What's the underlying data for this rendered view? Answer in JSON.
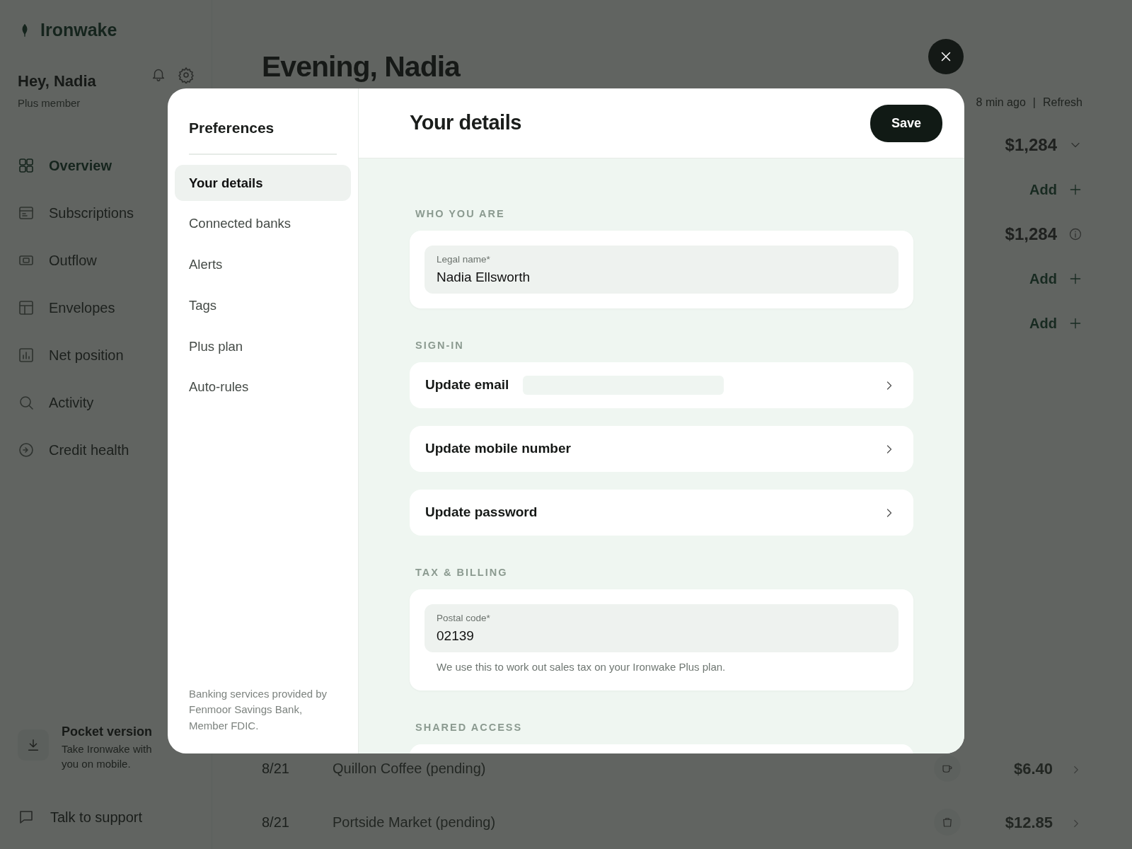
{
  "app": {
    "logo": "Ironwake",
    "greeting": "Hey, Nadia",
    "membership": "Plus member"
  },
  "sidebar": {
    "items": [
      {
        "label": "Overview",
        "kind": "grid",
        "selected": true
      },
      {
        "label": "Subscriptions",
        "kind": "card",
        "selected": false
      },
      {
        "label": "Outflow",
        "kind": "cash",
        "selected": false
      },
      {
        "label": "Envelopes",
        "kind": "layout",
        "selected": false
      },
      {
        "label": "Net position",
        "kind": "chart",
        "selected": false
      },
      {
        "label": "Activity",
        "kind": "search",
        "selected": false
      },
      {
        "label": "Credit health",
        "kind": "gauge",
        "selected": false
      }
    ],
    "promo": {
      "title": "Pocket version",
      "text": "Take Ironwake with you on mobile."
    },
    "support": "Talk to support"
  },
  "main": {
    "heading": "Evening, Nadia",
    "sync": {
      "status": "8 min ago",
      "separator": "|",
      "action": "Refresh"
    },
    "summary": [
      {
        "kind": "dropdown",
        "text": "$1,284"
      },
      {
        "kind": "add",
        "text": "Add"
      },
      {
        "kind": "info",
        "text": "$1,284"
      },
      {
        "kind": "add",
        "text": "Add"
      },
      {
        "kind": "add",
        "text": "Add"
      }
    ],
    "transactions": [
      {
        "date": "8/21",
        "merchant": "Quillon Coffee (pending)",
        "kind": "cup",
        "amount": "$6.40"
      },
      {
        "date": "8/21",
        "merchant": "Portside Market (pending)",
        "kind": "bag",
        "amount": "$12.85"
      }
    ]
  },
  "modal": {
    "title": "Preferences",
    "nav": [
      {
        "label": "Your details",
        "selected": true
      },
      {
        "label": "Connected banks",
        "selected": false
      },
      {
        "label": "Alerts",
        "selected": false
      },
      {
        "label": "Tags",
        "selected": false
      },
      {
        "label": "Plus plan",
        "selected": false
      },
      {
        "label": "Auto-rules",
        "selected": false
      }
    ],
    "footnote": "Banking services provided by Fenmoor Savings Bank, Member FDIC.",
    "page_title": "Your details",
    "save": "Save",
    "sections": [
      {
        "heading": "WHO YOU ARE",
        "items": [
          {
            "kind": "field",
            "label": "Legal name*",
            "value": "Nadia Ellsworth"
          }
        ]
      },
      {
        "heading": "SIGN-IN",
        "items": [
          {
            "kind": "link",
            "label": "Update email",
            "masked": true
          },
          {
            "kind": "link",
            "label": "Update mobile number"
          },
          {
            "kind": "link",
            "label": "Update password"
          }
        ]
      },
      {
        "heading": "TAX & BILLING",
        "items": [
          {
            "kind": "field",
            "label": "Postal code*",
            "value": "02139",
            "help": "We use this to work out sales tax on your Ironwake Plus plan."
          }
        ]
      },
      {
        "heading": "SHARED ACCESS",
        "items": [
          {
            "kind": "link"
          }
        ]
      }
    ]
  }
}
